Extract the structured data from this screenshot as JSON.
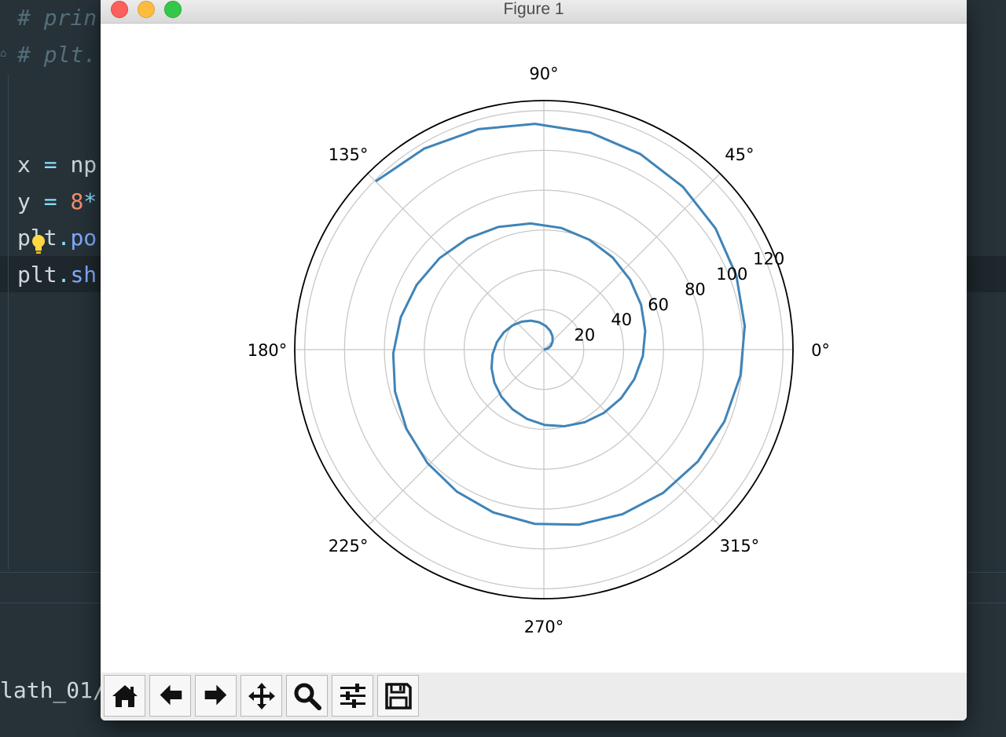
{
  "editor": {
    "lines": [
      {
        "text": "# prin"
      },
      {
        "text": "# plt."
      },
      {
        "x_var": "x",
        "eq": "=",
        "rest": "np"
      },
      {
        "y_var": "y",
        "eq": "=",
        "num": "8",
        "op": "*"
      },
      {
        "plt": "plt",
        "dot": ".",
        "fn": "po"
      },
      {
        "plt": "plt",
        "dot": ".",
        "fn": "sh"
      }
    ],
    "terminal_text": "lath_01/"
  },
  "window": {
    "title": "Figure 1"
  },
  "toolbar": {
    "buttons": [
      {
        "name": "home-icon"
      },
      {
        "name": "back-arrow-icon"
      },
      {
        "name": "forward-arrow-icon"
      },
      {
        "name": "pan-icon"
      },
      {
        "name": "zoom-icon"
      },
      {
        "name": "configure-subplots-icon"
      },
      {
        "name": "save-icon"
      }
    ]
  },
  "chart_data": {
    "type": "line",
    "projection": "polar",
    "description_formula": "r = 8*theta (Archimedean spiral)",
    "theta_range_deg": [
      0,
      855
    ],
    "r_coefficient_per_radian": 8,
    "rlim": [
      0,
      125
    ],
    "r_ticks": [
      20,
      40,
      60,
      80,
      100,
      120
    ],
    "r_tick_labels": [
      "20",
      "40",
      "60",
      "80",
      "100",
      "120"
    ],
    "theta_ticks_deg": [
      0,
      45,
      90,
      135,
      180,
      225,
      270,
      315
    ],
    "theta_tick_labels": [
      "0°",
      "45°",
      "90°",
      "135°",
      "180°",
      "225°",
      "270°",
      "315°"
    ],
    "grid": true,
    "series": [
      {
        "color": "#3f84b8"
      }
    ],
    "colors": {
      "line": "#3f84b8",
      "grid": "#c8c8c8",
      "frame": "#000000"
    }
  }
}
